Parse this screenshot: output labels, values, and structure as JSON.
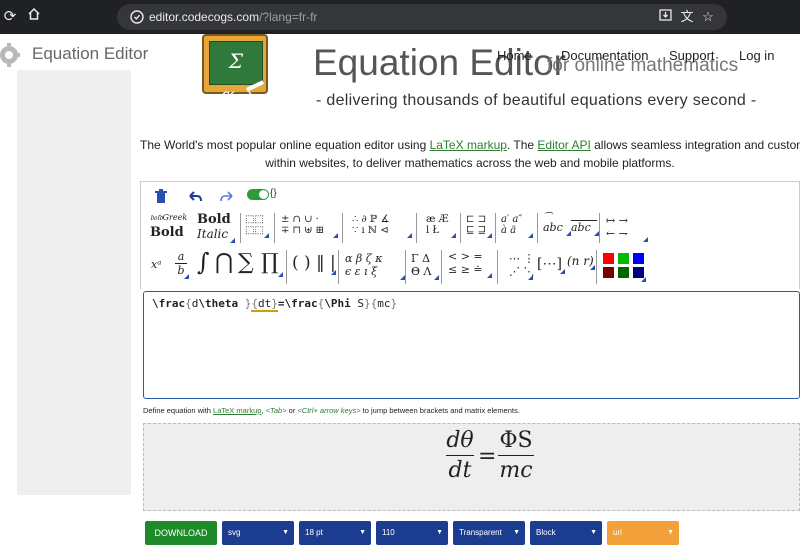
{
  "browser": {
    "url_host": "editor.codecogs.com",
    "url_path": "/?lang=fr-fr",
    "icons": [
      "reload-icon",
      "home-icon",
      "site-info-icon",
      "install-icon",
      "translate-icon",
      "bookmark-star-icon"
    ]
  },
  "site": {
    "brand": "Equation Editor",
    "logo_text": "Σ f(x)",
    "nav": [
      "Home",
      "Documentation",
      "Support",
      "Log in"
    ],
    "title": "Equation Editor",
    "subtitle": "for online mathematics",
    "tagline": "- delivering thousands of beautiful equations every second -",
    "intro": {
      "p1": "The World's most popular online equation editor using ",
      "link1": "LaTeX markup",
      "p2": ". The ",
      "link2": "Editor API",
      "p3": " allows seamless integration and customis",
      "line2": "within websites, to deliver mathematics across the web and mobile platforms."
    }
  },
  "toolbar": {
    "toggle_label": "{}",
    "row1": [
      {
        "name": "font-styles",
        "a": "𝔟𝔬𝔩𝔡Greek",
        "b": "Bold"
      },
      {
        "name": "font-styles-2",
        "a": "Bold",
        "b": "Italic"
      },
      {
        "name": "matrices",
        "a": "⬚⬚",
        "b": "⬚⬚"
      },
      {
        "name": "operators",
        "a": "± ∩ ∪ ·",
        "b": "∓ ⊓ ⊎ ⊞"
      },
      {
        "name": "logic",
        "a": "∴ ∂ ℙ ∡",
        "b": "∵ ı ℕ ⊲"
      },
      {
        "name": "special-letters",
        "a": "æ Æ",
        "b": "l Ł"
      },
      {
        "name": "subsets",
        "a": "⊏ ⊐",
        "b": "⊑ ⊒"
      },
      {
        "name": "accents",
        "a": "a′ a″",
        "b": "à ä"
      },
      {
        "name": "wide-accents",
        "a": "abc",
        "b": ""
      },
      {
        "name": "over-under",
        "a": "abc",
        "b": ""
      },
      {
        "name": "arrows",
        "a": "↦ →",
        "b": "← ⇁"
      }
    ],
    "row2": [
      {
        "name": "sup-sub",
        "a": "xᵃ"
      },
      {
        "name": "fraction",
        "a": "a/b"
      },
      {
        "name": "integral",
        "a": "∫"
      },
      {
        "name": "big-cap",
        "a": "⋂"
      },
      {
        "name": "sum",
        "a": "∑"
      },
      {
        "name": "product",
        "a": "∏"
      },
      {
        "name": "brackets",
        "a": "( ) ‖ |"
      },
      {
        "name": "greek-lower",
        "a": "α β ζ κ",
        "b": "ϵ ε ı ξ"
      },
      {
        "name": "greek-upper",
        "a": "Γ Δ",
        "b": "Θ Λ"
      },
      {
        "name": "relations",
        "a": "< > =",
        "b": "≤ ≥ ≐"
      },
      {
        "name": "dots",
        "a": "⋯ ⋮",
        "b": "⋰ ⋱"
      },
      {
        "name": "matrix-brackets",
        "a": "[⋯]"
      },
      {
        "name": "binomial",
        "a": "(n r)"
      }
    ],
    "colors": [
      "#ff0000",
      "#00bb00",
      "#0000ff",
      "#7a0000",
      "#006600",
      "#000080"
    ]
  },
  "editor": {
    "latex_parts": [
      "\\frac",
      "{",
      "d",
      "\\theta ",
      "}",
      "{",
      "dt",
      "}",
      "=\\frac",
      "{",
      "\\Phi ",
      "S",
      "}",
      "{",
      "mc",
      "}"
    ],
    "hint": {
      "p1": "Define equation with ",
      "link": "LaTeX markup",
      "p2": ", ",
      "k1": "<Tab>",
      "p3": " or ",
      "k2": "<Ctrl+ arrow keys>",
      "p4": " to jump between brackets and matrix elements."
    }
  },
  "preview": {
    "num1": "dθ",
    "den1": "dt",
    "equals": "=",
    "num2": "ΦS",
    "den2": "mc"
  },
  "output": {
    "download_label": "DOWNLOAD",
    "format": "svg",
    "size": "18 pt",
    "dpi": "110",
    "background": "Transparent",
    "display": "Block",
    "output_type": "url"
  }
}
